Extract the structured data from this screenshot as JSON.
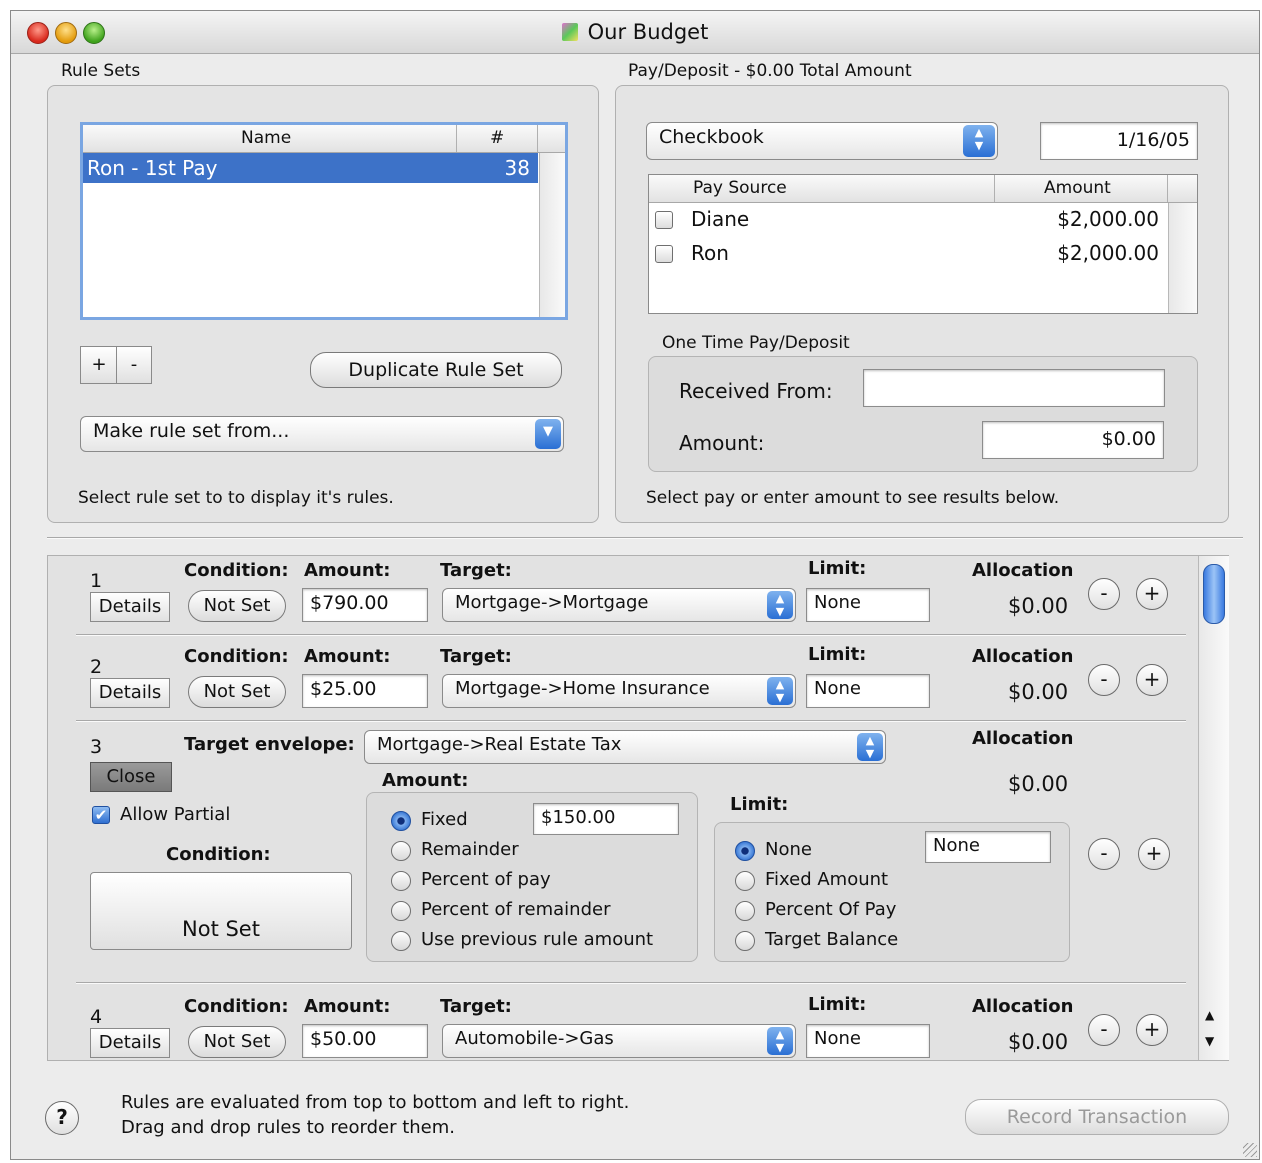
{
  "window": {
    "title": "Our Budget"
  },
  "rule_sets": {
    "group_label": "Rule Sets",
    "columns": [
      "Name",
      "#"
    ],
    "rows": [
      {
        "name": "Ron - 1st Pay",
        "count": "38"
      }
    ],
    "add_label": "+",
    "remove_label": "-",
    "duplicate_label": "Duplicate Rule Set",
    "make_from": "Make rule set from...",
    "hint": "Select rule set to to display it's rules."
  },
  "pay": {
    "group_label": "Pay/Deposit - $0.00 Total Amount",
    "account": "Checkbook",
    "date": "1/16/05",
    "columns": [
      "Pay Source",
      "Amount"
    ],
    "rows": [
      {
        "source": "Diane",
        "amount": "$2,000.00"
      },
      {
        "source": "Ron",
        "amount": "$2,000.00"
      }
    ],
    "one_time_label": "One Time Pay/Deposit",
    "received_from_label": "Received From:",
    "received_from_value": "",
    "amount_label": "Amount:",
    "amount_value": "$0.00",
    "hint": "Select pay or enter amount to see results below."
  },
  "rules_labels": {
    "condition": "Condition:",
    "amount": "Amount:",
    "target": "Target:",
    "limit": "Limit:",
    "allocation": "Allocation",
    "details": "Details",
    "minus": "-",
    "plus": "+"
  },
  "rules": [
    {
      "num": "1",
      "condition": "Not Set",
      "amount": "$790.00",
      "target": "Mortgage->Mortgage",
      "limit": "None",
      "allocation": "$0.00"
    },
    {
      "num": "2",
      "condition": "Not Set",
      "amount": "$25.00",
      "target": "Mortgage->Home Insurance",
      "limit": "None",
      "allocation": "$0.00"
    },
    {
      "num": "4",
      "condition": "Not Set",
      "amount": "$50.00",
      "target": "Automobile->Gas",
      "limit": "None",
      "allocation": "$0.00"
    }
  ],
  "expanded_rule": {
    "num": "3",
    "target_envelope_label": "Target envelope:",
    "target_envelope": "Mortgage->Real Estate Tax",
    "close_label": "Close",
    "allow_partial_label": "Allow Partial",
    "allow_partial": true,
    "condition_label": "Condition:",
    "condition_value": "Not Set",
    "amount_label": "Amount:",
    "amount_options": [
      "Fixed",
      "Remainder",
      "Percent of pay",
      "Percent of remainder",
      "Use previous rule amount"
    ],
    "amount_selected": "Fixed",
    "fixed_value": "$150.00",
    "limit_label": "Limit:",
    "limit_options": [
      "None",
      "Fixed Amount",
      "Percent Of Pay",
      "Target Balance"
    ],
    "limit_selected": "None",
    "limit_value": "None",
    "allocation_label": "Allocation",
    "allocation": "$0.00"
  },
  "footer": {
    "help": "?",
    "line1": "Rules are evaluated from top to bottom and left to right.",
    "line2": "Drag and drop rules to reorder them.",
    "record_label": "Record Transaction"
  },
  "colors": {
    "selection": "#3d72c8",
    "window_bg": "#ececec",
    "accent": "#2a6fd4"
  }
}
